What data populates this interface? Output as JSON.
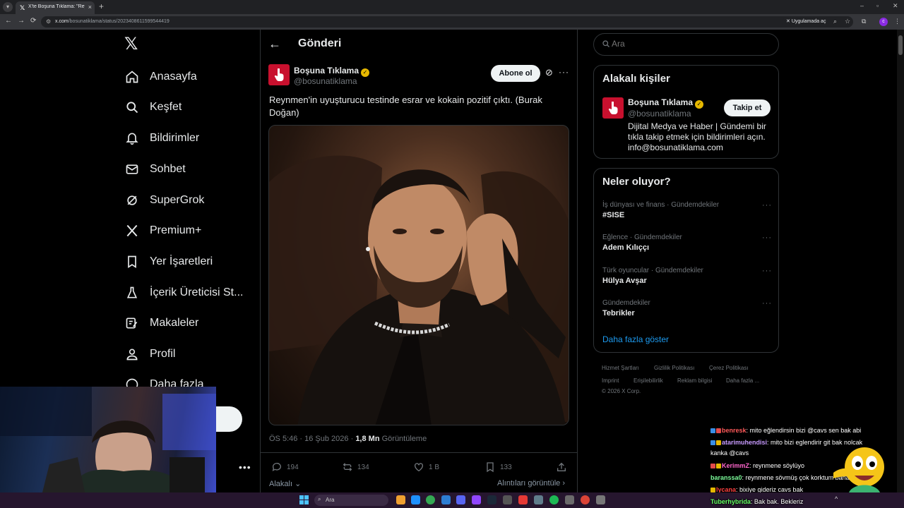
{
  "browser": {
    "tab_title": "X'te Boşuna Tıklama: \"Reynmen",
    "url_domain": "x.com",
    "url_path": "/bosunatiklama/status/2023408611599544419",
    "open_in_app": "Uygulamada aç"
  },
  "nav": {
    "home": "Anasayfa",
    "explore": "Keşfet",
    "notifications": "Bildirimler",
    "messages": "Sohbet",
    "grok": "SuperGrok",
    "premium": "Premium+",
    "bookmarks": "Yer İşaretleri",
    "creator": "İçerik Üreticisi St...",
    "articles": "Makaleler",
    "profile": "Profil",
    "more": "Daha fazla"
  },
  "post": {
    "header_title": "Gönderi",
    "author_name": "Boşuna Tıklama",
    "author_handle": "@bosunatiklama",
    "subscribe_label": "Abone ol",
    "text": "Reynmen'in uyuşturucu testinde esrar ve kokain pozitif çıktı. (Burak Doğan)",
    "timestamp": "ÖS 5:46 · 16 Şub 2026 · ",
    "views_count": "1,8 Mn",
    "views_label": " Görüntüleme",
    "replies": "194",
    "reposts": "134",
    "likes": "1 B",
    "bookmarks": "133",
    "related_label": "Alakalı",
    "quotes_label": "Alıntıları görüntüle"
  },
  "sidebar": {
    "search_placeholder": "Ara",
    "related_title": "Alakalı kişiler",
    "related_person": {
      "name": "Boşuna Tıklama",
      "handle": "@bosunatiklama",
      "follow_label": "Takip et",
      "bio": "Dijital Medya ve Haber | Gündemi bir tıkla takip etmek için bildirimleri açın. info@bosunatiklama.com"
    },
    "trends_title": "Neler oluyor?",
    "trends": [
      {
        "context": "İş dünyası ve finans · Gündemdekiler",
        "name": "#SISE"
      },
      {
        "context": "Eğlence · Gündemdekiler",
        "name": "Adem Kılıççı"
      },
      {
        "context": "Türk oyuncular · Gündemdekiler",
        "name": "Hülya Avşar"
      },
      {
        "context": "Gündemdekiler",
        "name": "Tebrikler"
      }
    ],
    "show_more": "Daha fazla göster",
    "footer": {
      "terms": "Hizmet Şartları",
      "privacy": "Gizlilik Politikası",
      "cookies": "Çerez Politikası",
      "imprint": "Imprint",
      "accessibility": "Erişilebilirlik",
      "ads": "Reklam bilgisi",
      "more": "Daha fazla ...",
      "copyright": "© 2026 X Corp."
    }
  },
  "chat": [
    {
      "user": "benresk",
      "color": "#ff5a5a",
      "message": ": mito eğlendirsin bizi @cavs sen bak abi"
    },
    {
      "user": "atarimuhendisi",
      "color": "#c89bff",
      "message": ": mito bizi eglendirir git bak nolcak"
    },
    {
      "user": "",
      "color": "#ffffff",
      "message": "kanka @cavs"
    },
    {
      "user": "KerimmZ",
      "color": "#ff66cc",
      "message": ": reynmene söylüyo"
    },
    {
      "user": "baranssa0",
      "color": "#7CFC9A",
      "message": ": reynmene sövmüş çok korktum bana"
    },
    {
      "user": "lycana",
      "color": "#ff4040",
      "message": ": bixiye gideriz cavs bak"
    },
    {
      "user": "Tuberhybrida",
      "color": "#66ff66",
      "message": ": Bak bak. Bekleriz"
    }
  ],
  "taskbar": {
    "search_placeholder": "Ara"
  },
  "colors": {
    "accent": "#1d9bf0",
    "brand_red": "#c8102e",
    "verified_gold": "#e6b800"
  }
}
